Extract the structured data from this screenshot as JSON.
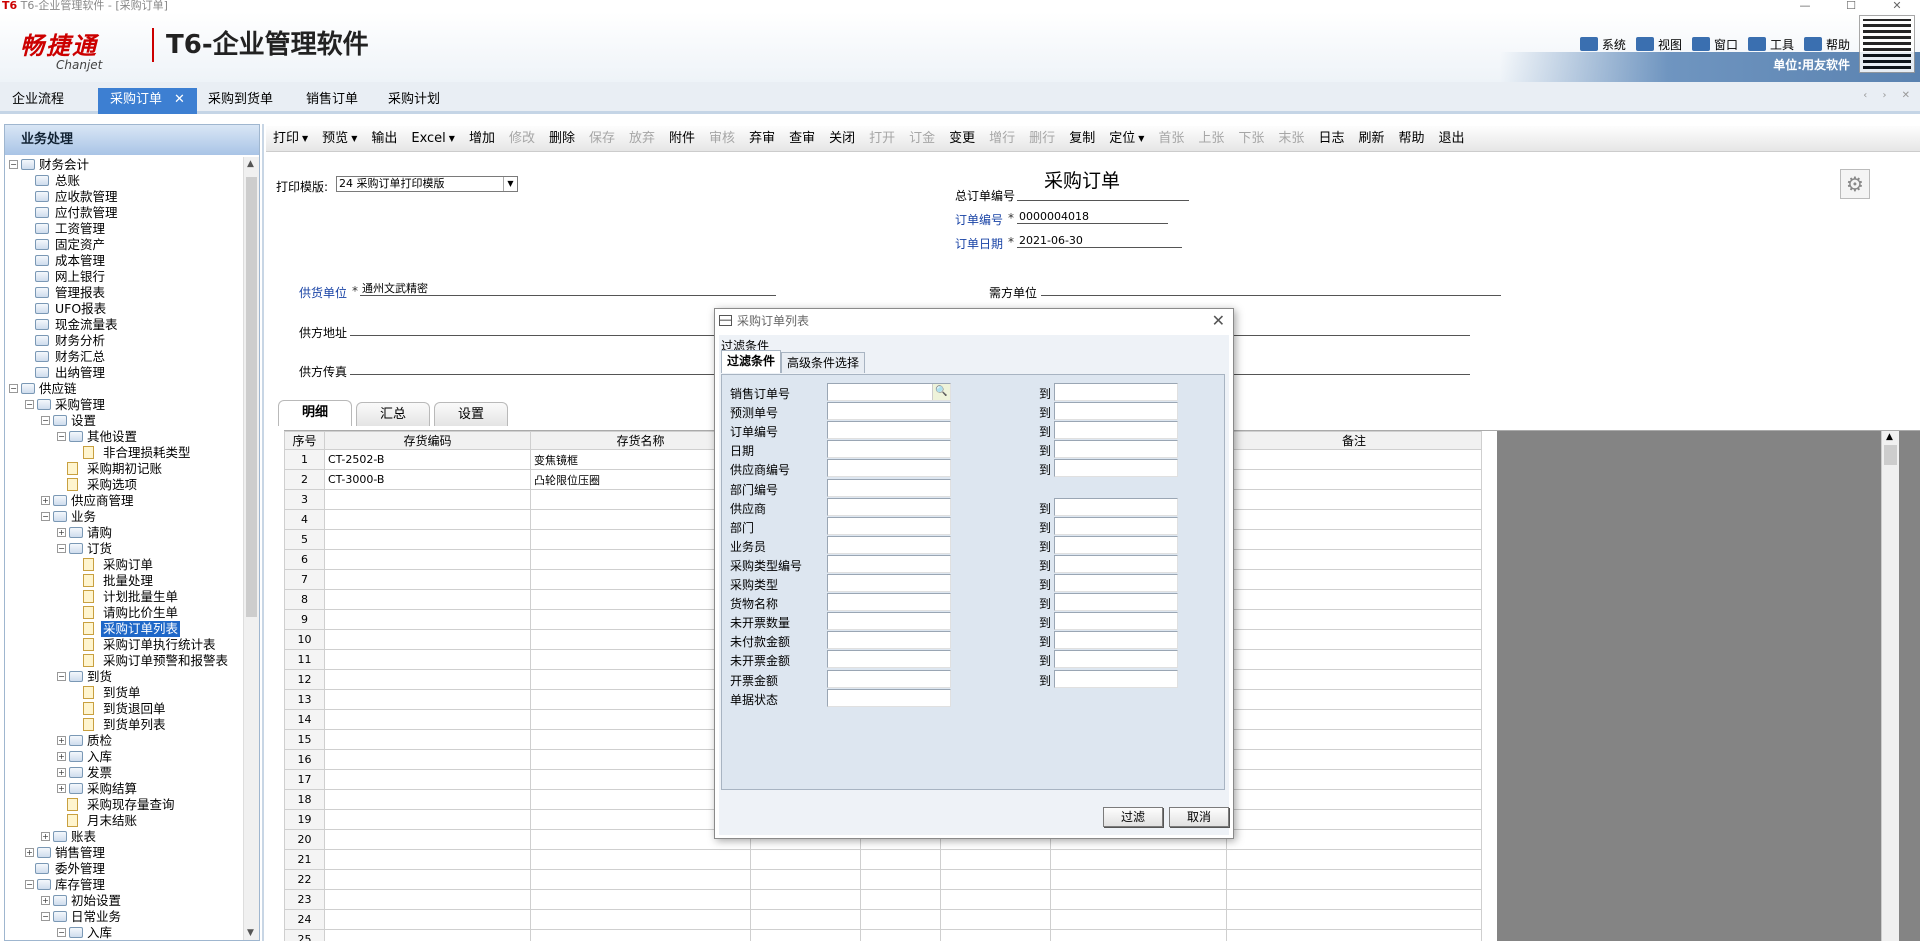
{
  "window": {
    "title": "T6-企业管理软件 - [采购订单]",
    "logo": "T6",
    "controls": [
      "—",
      "☐",
      "✕"
    ]
  },
  "brand": {
    "name_cn": "畅捷通",
    "name_en": "Chanjet",
    "product": "T6-企业管理软件"
  },
  "topmenu": [
    {
      "label": "系统",
      "icon": "monitor-icon"
    },
    {
      "label": "视图",
      "icon": "grid-view-icon"
    },
    {
      "label": "窗口",
      "icon": "window-icon"
    },
    {
      "label": "工具",
      "icon": "tools-icon"
    },
    {
      "label": "帮助",
      "icon": "help-icon"
    }
  ],
  "unit": "单位:用友软件",
  "tabs": [
    {
      "label": "企业流程"
    },
    {
      "label": "采购订单",
      "active": true,
      "close": "✕"
    },
    {
      "label": "采购到货单"
    },
    {
      "label": "销售订单"
    },
    {
      "label": "采购计划"
    }
  ],
  "tab_controls": "‹ › ✕",
  "sidebar": {
    "title": "业务处理",
    "tree": [
      {
        "label": "财务会计",
        "level": 0,
        "exp": "-",
        "type": "folder"
      },
      {
        "label": "总账",
        "level": 1,
        "type": "folder"
      },
      {
        "label": "应收款管理",
        "level": 1,
        "type": "folder"
      },
      {
        "label": "应付款管理",
        "level": 1,
        "type": "folder"
      },
      {
        "label": "工资管理",
        "level": 1,
        "type": "folder"
      },
      {
        "label": "固定资产",
        "level": 1,
        "type": "folder"
      },
      {
        "label": "成本管理",
        "level": 1,
        "type": "folder"
      },
      {
        "label": "网上银行",
        "level": 1,
        "type": "folder"
      },
      {
        "label": "管理报表",
        "level": 1,
        "type": "folder"
      },
      {
        "label": "UFO报表",
        "level": 1,
        "type": "folder"
      },
      {
        "label": "现金流量表",
        "level": 1,
        "type": "folder"
      },
      {
        "label": "财务分析",
        "level": 1,
        "type": "folder"
      },
      {
        "label": "财务汇总",
        "level": 1,
        "type": "folder"
      },
      {
        "label": "出纳管理",
        "level": 1,
        "type": "folder"
      },
      {
        "label": "供应链",
        "level": 0,
        "exp": "-",
        "type": "folder"
      },
      {
        "label": "采购管理",
        "level": 1,
        "exp": "-",
        "type": "folder"
      },
      {
        "label": "设置",
        "level": 2,
        "exp": "-",
        "type": "folder"
      },
      {
        "label": "其他设置",
        "level": 3,
        "exp": "-",
        "type": "folder"
      },
      {
        "label": "非合理损耗类型",
        "level": 4,
        "type": "page"
      },
      {
        "label": "采购期初记账",
        "level": 3,
        "type": "page"
      },
      {
        "label": "采购选项",
        "level": 3,
        "type": "page"
      },
      {
        "label": "供应商管理",
        "level": 2,
        "exp": "+",
        "type": "folder"
      },
      {
        "label": "业务",
        "level": 2,
        "exp": "-",
        "type": "folder"
      },
      {
        "label": "请购",
        "level": 3,
        "exp": "+",
        "type": "folder"
      },
      {
        "label": "订货",
        "level": 3,
        "exp": "-",
        "type": "folder"
      },
      {
        "label": "采购订单",
        "level": 4,
        "type": "page"
      },
      {
        "label": "批量处理",
        "level": 4,
        "type": "page"
      },
      {
        "label": "计划批量生单",
        "level": 4,
        "type": "page"
      },
      {
        "label": "请购比价生单",
        "level": 4,
        "type": "page"
      },
      {
        "label": "采购订单列表",
        "level": 4,
        "type": "page",
        "selected": true
      },
      {
        "label": "采购订单执行统计表",
        "level": 4,
        "type": "page"
      },
      {
        "label": "采购订单预警和报警表",
        "level": 4,
        "type": "page"
      },
      {
        "label": "到货",
        "level": 3,
        "exp": "-",
        "type": "folder"
      },
      {
        "label": "到货单",
        "level": 4,
        "type": "page"
      },
      {
        "label": "到货退回单",
        "level": 4,
        "type": "page"
      },
      {
        "label": "到货单列表",
        "level": 4,
        "type": "page"
      },
      {
        "label": "质检",
        "level": 3,
        "exp": "+",
        "type": "folder"
      },
      {
        "label": "入库",
        "level": 3,
        "exp": "+",
        "type": "folder"
      },
      {
        "label": "发票",
        "level": 3,
        "exp": "+",
        "type": "folder"
      },
      {
        "label": "采购结算",
        "level": 3,
        "exp": "+",
        "type": "folder"
      },
      {
        "label": "采购现存量查询",
        "level": 3,
        "type": "page"
      },
      {
        "label": "月末结账",
        "level": 3,
        "type": "page"
      },
      {
        "label": "账表",
        "level": 2,
        "exp": "+",
        "type": "folder"
      },
      {
        "label": "销售管理",
        "level": 1,
        "exp": "+",
        "type": "folder"
      },
      {
        "label": "委外管理",
        "level": 1,
        "type": "folder"
      },
      {
        "label": "库存管理",
        "level": 1,
        "exp": "-",
        "type": "folder"
      },
      {
        "label": "初始设置",
        "level": 2,
        "exp": "+",
        "type": "folder"
      },
      {
        "label": "日常业务",
        "level": 2,
        "exp": "-",
        "type": "folder"
      },
      {
        "label": "入库",
        "level": 3,
        "exp": "-",
        "type": "folder"
      }
    ]
  },
  "toolbar": [
    {
      "label": "打印",
      "dd": true
    },
    {
      "label": "预览",
      "dd": true
    },
    {
      "label": "输出"
    },
    {
      "label": "Excel",
      "dd": true
    },
    {
      "label": "增加"
    },
    {
      "label": "修改",
      "disabled": true
    },
    {
      "label": "删除"
    },
    {
      "label": "保存",
      "disabled": true
    },
    {
      "label": "放弃",
      "disabled": true
    },
    {
      "label": "附件"
    },
    {
      "label": "审核",
      "disabled": true
    },
    {
      "label": "弃审"
    },
    {
      "label": "查审"
    },
    {
      "label": "关闭"
    },
    {
      "label": "打开",
      "disabled": true
    },
    {
      "label": "订金",
      "disabled": true
    },
    {
      "label": "变更"
    },
    {
      "label": "增行",
      "disabled": true
    },
    {
      "label": "删行",
      "disabled": true
    },
    {
      "label": "复制"
    },
    {
      "label": "定位",
      "dd": true
    },
    {
      "label": "首张",
      "disabled": true
    },
    {
      "label": "上张",
      "disabled": true
    },
    {
      "label": "下张",
      "disabled": true
    },
    {
      "label": "末张",
      "disabled": true
    },
    {
      "label": "日志"
    },
    {
      "label": "刷新"
    },
    {
      "label": "帮助"
    },
    {
      "label": "退出"
    }
  ],
  "form": {
    "print_template_label": "打印模版:",
    "print_template_value": "24 采购订单打印模版",
    "doc_title": "采购订单",
    "total_order_no_label": "总订单编号",
    "order_no_label": "订单编号",
    "order_no_value": "0000004018",
    "order_date_label": "订单日期",
    "order_date_value": "2021-06-30",
    "supplier_label": "供货单位",
    "supplier_value": "通州文武精密",
    "demand_unit_label": "需方单位",
    "supplier_address_label": "供方地址",
    "supplier_fax_label": "供方传真",
    "required_mark": "*"
  },
  "grid": {
    "tabs": [
      "明细",
      "汇总",
      "设置"
    ],
    "columns": [
      "序号",
      "存货编码",
      "存货名称",
      "",
      "",
      "",
      "",
      "备注"
    ],
    "rows": [
      {
        "no": "1",
        "code": "CT-2502-B",
        "name": "变焦镜框"
      },
      {
        "no": "2",
        "code": "CT-3000-B",
        "name": "凸轮限位压圈"
      },
      {
        "no": "3"
      },
      {
        "no": "4"
      },
      {
        "no": "5"
      },
      {
        "no": "6"
      },
      {
        "no": "7"
      },
      {
        "no": "8"
      },
      {
        "no": "9"
      },
      {
        "no": "10"
      },
      {
        "no": "11"
      },
      {
        "no": "12"
      },
      {
        "no": "13"
      },
      {
        "no": "14"
      },
      {
        "no": "15"
      },
      {
        "no": "16"
      },
      {
        "no": "17"
      },
      {
        "no": "18"
      },
      {
        "no": "19"
      },
      {
        "no": "20"
      },
      {
        "no": "21"
      },
      {
        "no": "22"
      },
      {
        "no": "23"
      },
      {
        "no": "24"
      },
      {
        "no": "25"
      }
    ]
  },
  "dialog": {
    "title": "采购订单列表",
    "section": "过滤条件",
    "tabs": [
      "过滤条件",
      "高级条件选择"
    ],
    "to_label": "到",
    "fields": [
      {
        "label": "销售订单号",
        "range": true,
        "lookup": true
      },
      {
        "label": "预测单号",
        "range": true
      },
      {
        "label": "订单编号",
        "range": true
      },
      {
        "label": "日期",
        "range": true
      },
      {
        "label": "供应商编号",
        "range": true
      },
      {
        "label": "部门编号",
        "range": false
      },
      {
        "label": "供应商",
        "range": true
      },
      {
        "label": "部门",
        "range": true
      },
      {
        "label": "业务员",
        "range": true
      },
      {
        "label": "采购类型编号",
        "range": true
      },
      {
        "label": "采购类型",
        "range": true
      },
      {
        "label": "货物名称",
        "range": true
      },
      {
        "label": "未开票数量",
        "range": true
      },
      {
        "label": "未付款金额",
        "range": true
      },
      {
        "label": "未开票金额",
        "range": true
      },
      {
        "label": "开票金额",
        "range": true
      },
      {
        "label": "单据状态",
        "range": false
      }
    ],
    "filter_button": "过滤",
    "cancel_button": "取消"
  }
}
